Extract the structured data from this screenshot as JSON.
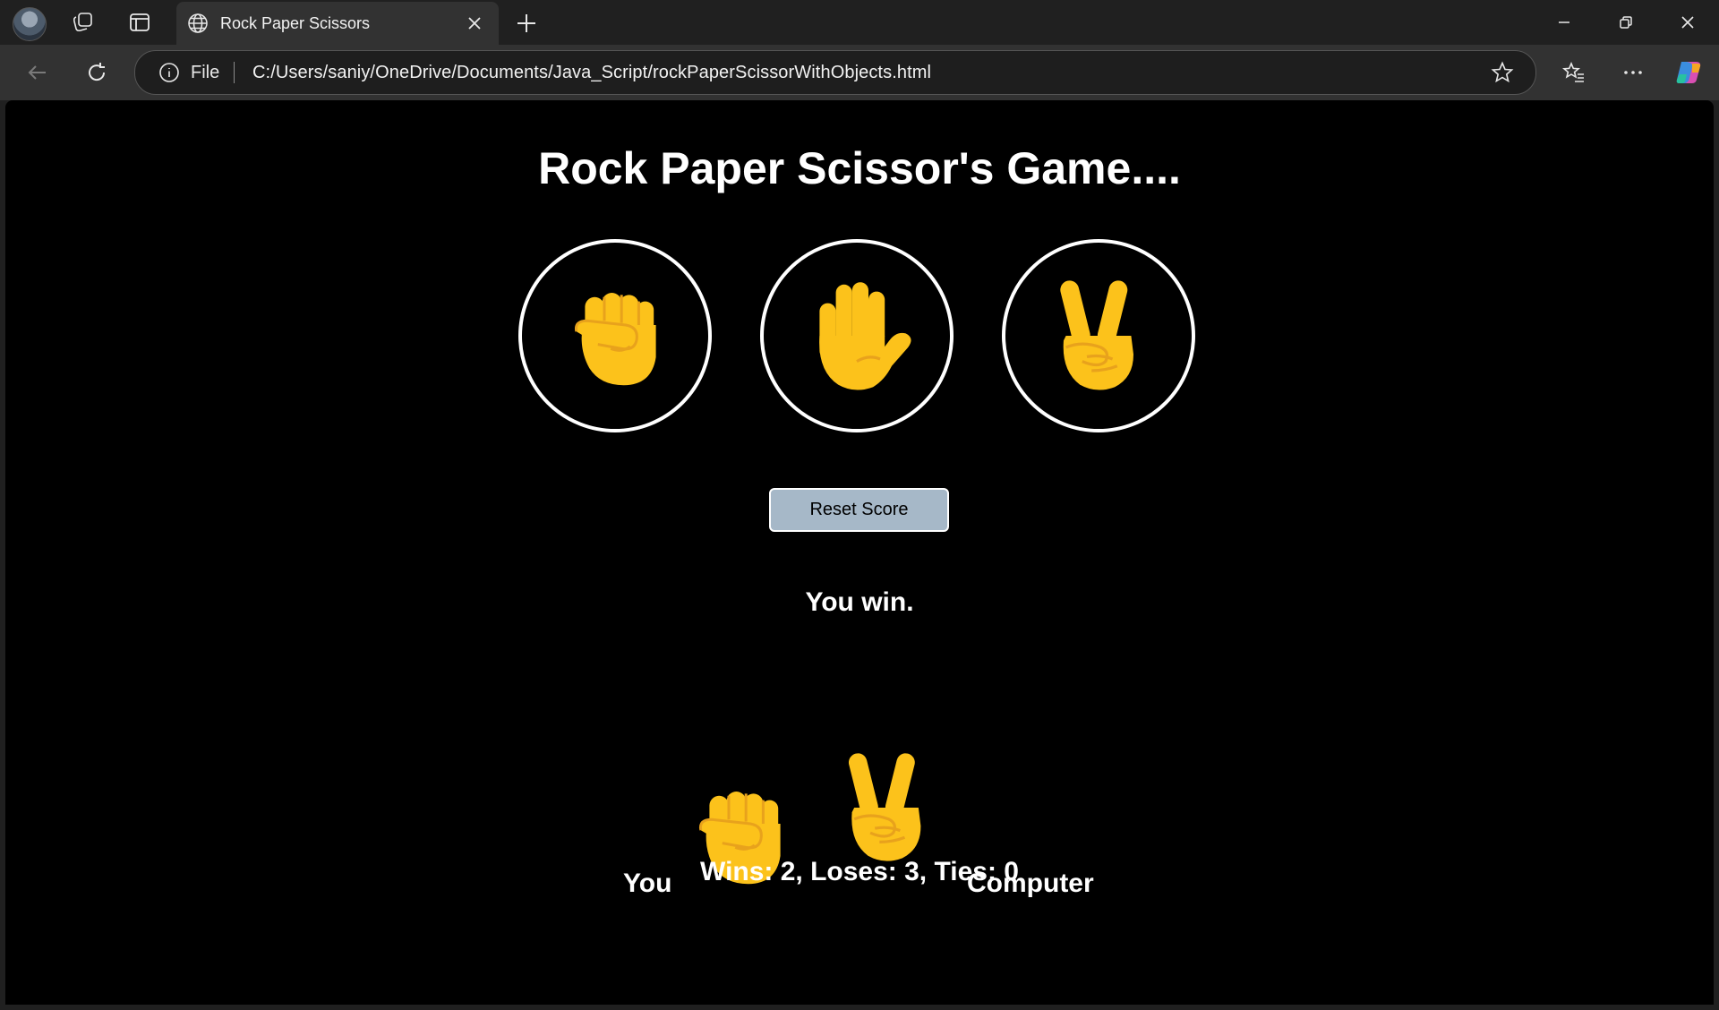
{
  "browser": {
    "tab_title": "Rock Paper Scissors",
    "scheme_label": "File",
    "url": "C:/Users/saniy/OneDrive/Documents/Java_Script/rockPaperScissorWithObjects.html"
  },
  "game": {
    "title": "Rock Paper Scissor's Game....",
    "moves": [
      {
        "name": "rock",
        "icon": "fist-icon"
      },
      {
        "name": "paper",
        "icon": "raised-hand-icon"
      },
      {
        "name": "scissors",
        "icon": "victory-hand-icon"
      }
    ],
    "reset_label": "Reset Score",
    "result": "You win.",
    "player_label": "You",
    "player_move_icon": "fist-icon",
    "computer_move_icon": "victory-hand-icon",
    "computer_label": "Computer",
    "score": "Wins: 2, Loses: 3, Ties: 0"
  },
  "colors": {
    "emoji_fill": "#FCC21B",
    "emoji_line": "#E8A21C",
    "reset_button": "#A6B8C8",
    "page_bg": "#000000"
  }
}
